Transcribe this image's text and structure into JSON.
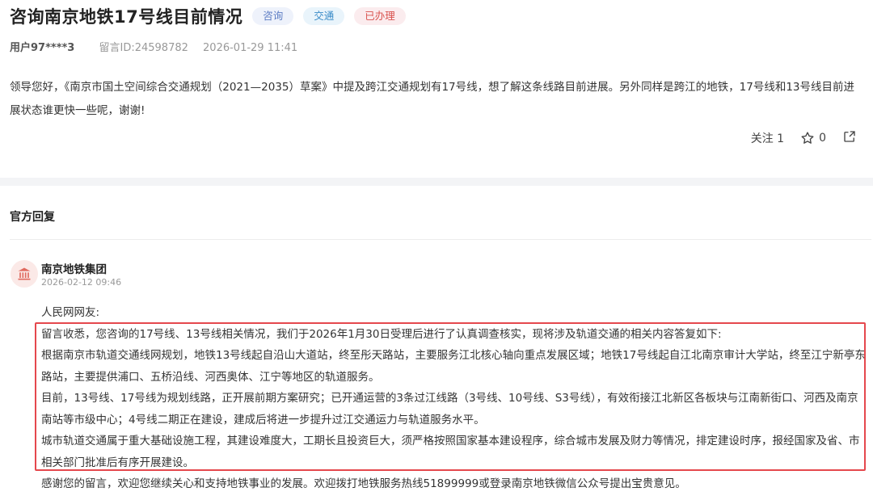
{
  "question": {
    "title": "咨询南京地铁17号线目前情况",
    "tags": [
      "咨询",
      "交通",
      "已办理"
    ],
    "user": "用户97****3",
    "message_id": "留言ID:24598782",
    "datetime": "2026-01-29 11:41",
    "body": "领导您好，《南京市国土空间综合交通规划（2021—2035）草案》中提及跨江交通规划有17号线，想了解这条线路目前进展。另外同样是跨江的地铁，17号线和13号线目前进展状态谁更快一些呢，谢谢!",
    "follow_label": "关注 1",
    "like_count": "0"
  },
  "reply_section": {
    "heading": "官方回复",
    "org_name": "南京地铁集团",
    "date": "2026-02-12 09:46",
    "paragraphs": [
      "人民网网友:",
      "留言收悉，您咨询的17号线、13号线相关情况，我们于2026年1月30日受理后进行了认真调查核实，现将涉及轨道交通的相关内容答复如下:",
      "根据南京市轨道交通线网规划，地铁13号线起自沿山大道站，终至彤天路站，主要服务江北核心轴向重点发展区域；地铁17号线起自江北南京审计大学站，终至江宁新亭东路站，主要提供浦口、五桥沿线、河西奥体、江宁等地区的轨道服务。",
      "目前，13号线、17号线为规划线路，正开展前期方案研究；已开通运营的3条过江线路（3号线、10号线、S3号线），有效衔接江北新区各板块与江南新街口、河西及南京南站等市级中心；4号线二期正在建设，建成后将进一步提升过江交通运力与轨道服务水平。",
      "城市轨道交通属于重大基础设施工程，其建设难度大，工期长且投资巨大，须严格按照国家基本建设程序，综合城市发展及财力等情况，排定建设时序，报经国家及省、市相关部门批准后有序开展建设。",
      "感谢您的留言，欢迎您继续关心和支持地铁事业的发展。欢迎拨打地铁服务热线51899999或登录南京地铁微信公众号提出宝贵意见。"
    ]
  },
  "icons": {
    "star": "star-outline-icon",
    "share": "share-icon",
    "org": "government-building-icon"
  },
  "colors": {
    "highlight_border": "#e5484d",
    "tag_status": "#d9534f",
    "tag_topic": "#3b8cc8"
  }
}
